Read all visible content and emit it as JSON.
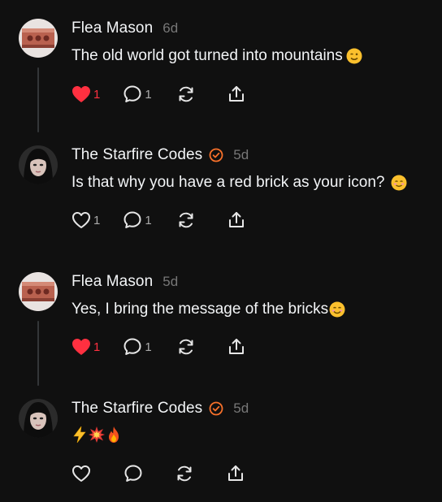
{
  "posts": [
    {
      "author": "Flea Mason",
      "verified": false,
      "time": "6d",
      "text": "The old world got turned into mountains",
      "emoji": "wink",
      "liked": true,
      "likes": "1",
      "replies": "1",
      "avatar": "brick-icon"
    },
    {
      "author": "The Starfire Codes",
      "verified": true,
      "time": "5d",
      "text": "Is that why you have a red brick as your icon?",
      "emoji": "relieved-smile",
      "liked": false,
      "likes": "1",
      "replies": "1",
      "avatar": "person-photo"
    },
    {
      "author": "Flea Mason",
      "verified": false,
      "time": "5d",
      "text": "Yes, I bring the message of the bricks",
      "emoji": "smile",
      "liked": true,
      "likes": "1",
      "replies": "1",
      "avatar": "brick-icon"
    },
    {
      "author": "The Starfire Codes",
      "verified": true,
      "time": "5d",
      "text": "",
      "emoji": "lightning-collision-fire",
      "liked": false,
      "likes": "",
      "replies": "",
      "avatar": "person-photo"
    }
  ],
  "colors": {
    "background": "#101010",
    "like_red": "#ff3040",
    "verified_orange": "#f7702a",
    "muted": "#777777"
  }
}
